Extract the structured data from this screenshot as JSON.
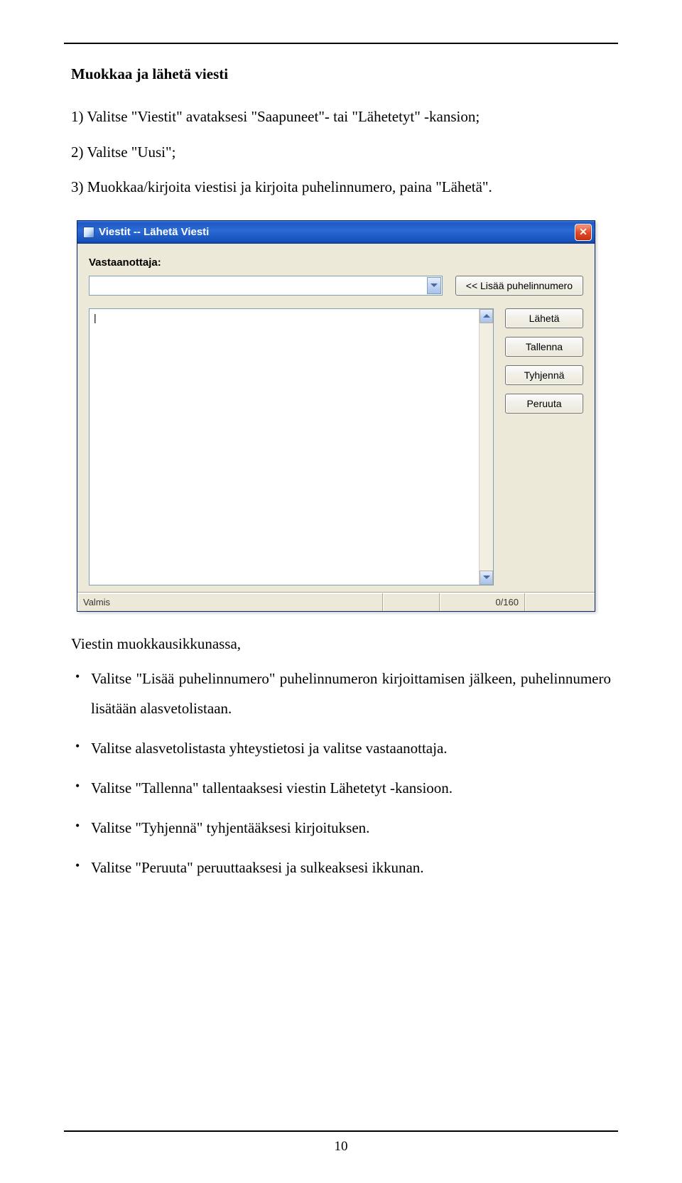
{
  "section_title": "Muokkaa ja lähetä viesti",
  "steps": [
    "1) Valitse \"Viestit\" avataksesi \"Saapuneet\"- tai \"Lähetetyt\" -kansion;",
    "2) Valitse \"Uusi\";",
    "3) Muokkaa/kirjoita viestisi ja kirjoita puhelinnumero, paina \"Lähetä\"."
  ],
  "window": {
    "title": "Viestit -- Lähetä Viesti",
    "recipient_label": "Vastaanottaja:",
    "combo_value": "",
    "add_number_btn": "<<  Lisää puhelinnumero",
    "message_text": "|",
    "buttons": {
      "send": "Lähetä",
      "save": "Tallenna",
      "clear": "Tyhjennä",
      "cancel": "Peruuta"
    },
    "status_left": "Valmis",
    "status_count": "0/160"
  },
  "after_window_text": "Viestin muokkausikkunassa,",
  "bullets": [
    "Valitse \"Lisää puhelinnumero\" puhelinnumeron kirjoittamisen jälkeen, puhelinnumero lisätään alasvetolistaan.",
    "Valitse alasvetolistasta yhteystietosi ja valitse vastaanottaja.",
    "Valitse \"Tallenna\" tallentaaksesi viestin Lähetetyt -kansioon.",
    "Valitse \"Tyhjennä\" tyhjentääksesi kirjoituksen.",
    "Valitse \"Peruuta\" peruuttaaksesi ja sulkeaksesi ikkunan."
  ],
  "page_number": "10"
}
